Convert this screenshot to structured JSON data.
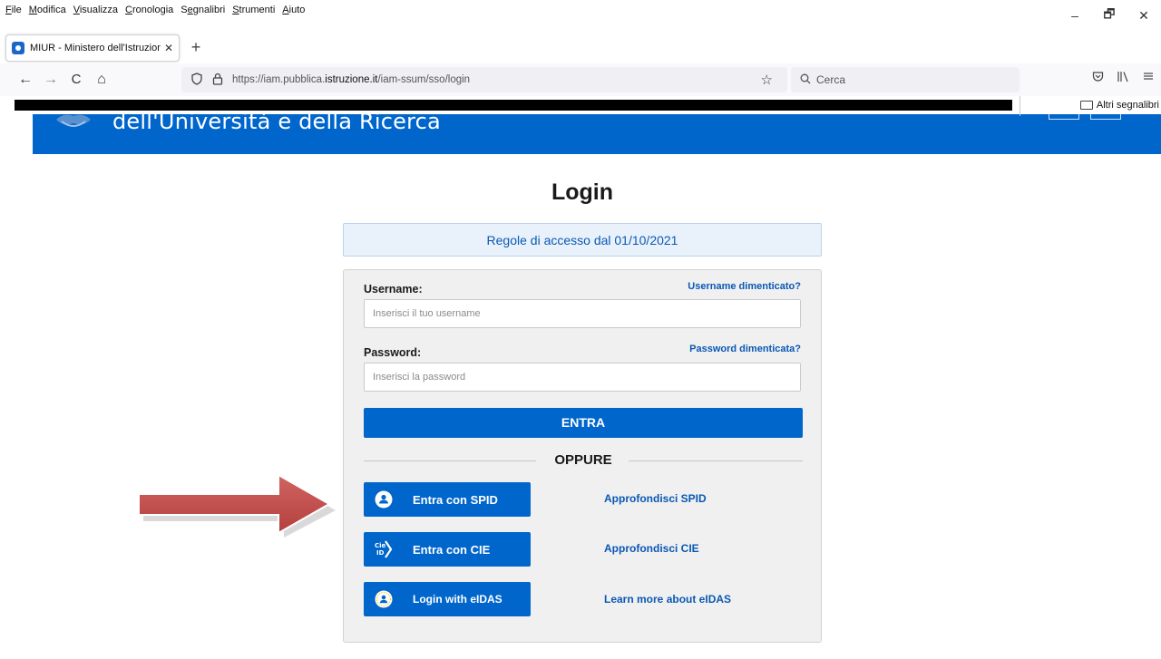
{
  "menubar": {
    "items": [
      {
        "accel": "F",
        "rest": "ile"
      },
      {
        "accel": "M",
        "rest": "odifica"
      },
      {
        "accel": "V",
        "rest": "isualizza"
      },
      {
        "accel": "C",
        "rest": "ronologia"
      },
      {
        "accel": "",
        "pre": "S",
        "accel2": "e",
        "rest": "gnalibri"
      },
      {
        "accel": "S",
        "rest": "trumenti"
      },
      {
        "accel": "A",
        "rest": "iuto"
      }
    ],
    "window_controls": [
      "–",
      "🗗",
      "✕"
    ]
  },
  "tab": {
    "title": "MIUR - Ministero dell'Istruzione",
    "close": "✕",
    "new_tab": "+"
  },
  "navbar": {
    "back": "←",
    "forward": "→",
    "reload": "C",
    "home": "⌂",
    "url_prefix": "https://iam.pubblica.",
    "url_domain": "istruzione.it",
    "url_path": "/iam-ssum/sso/login",
    "star": "☆",
    "search_placeholder": "Cerca",
    "right_icons": [
      "pocket-icon",
      "library-icon",
      "menu-icon"
    ]
  },
  "bookmarks": {
    "other": "Altri segnalibri"
  },
  "header": {
    "title": "dell'Università e della Ricerca",
    "brand_color": "#0066cc"
  },
  "login": {
    "title": "Login",
    "rules": "Regole di accesso dal 01/10/2021",
    "username_label": "Username:",
    "username_forgot": "Username dimenticato?",
    "username_placeholder": "Inserisci il tuo username",
    "password_label": "Password:",
    "password_forgot": "Password dimenticata?",
    "password_placeholder": "Inserisci la password",
    "submit": "ENTRA",
    "separator": "OPPURE",
    "alternatives": [
      {
        "label": "Entra con SPID",
        "icon": "spid-user-icon",
        "link": "Approfondisci SPID"
      },
      {
        "label": "Entra con CIE",
        "icon": "cie-id-icon",
        "link": "Approfondisci CIE"
      },
      {
        "label": "Login with eIDAS",
        "icon": "eidas-user-icon",
        "link": "Learn more about eIDAS"
      }
    ]
  },
  "annotation": {
    "arrow_color": "#c0504d",
    "points_to": "Entra con SPID"
  }
}
